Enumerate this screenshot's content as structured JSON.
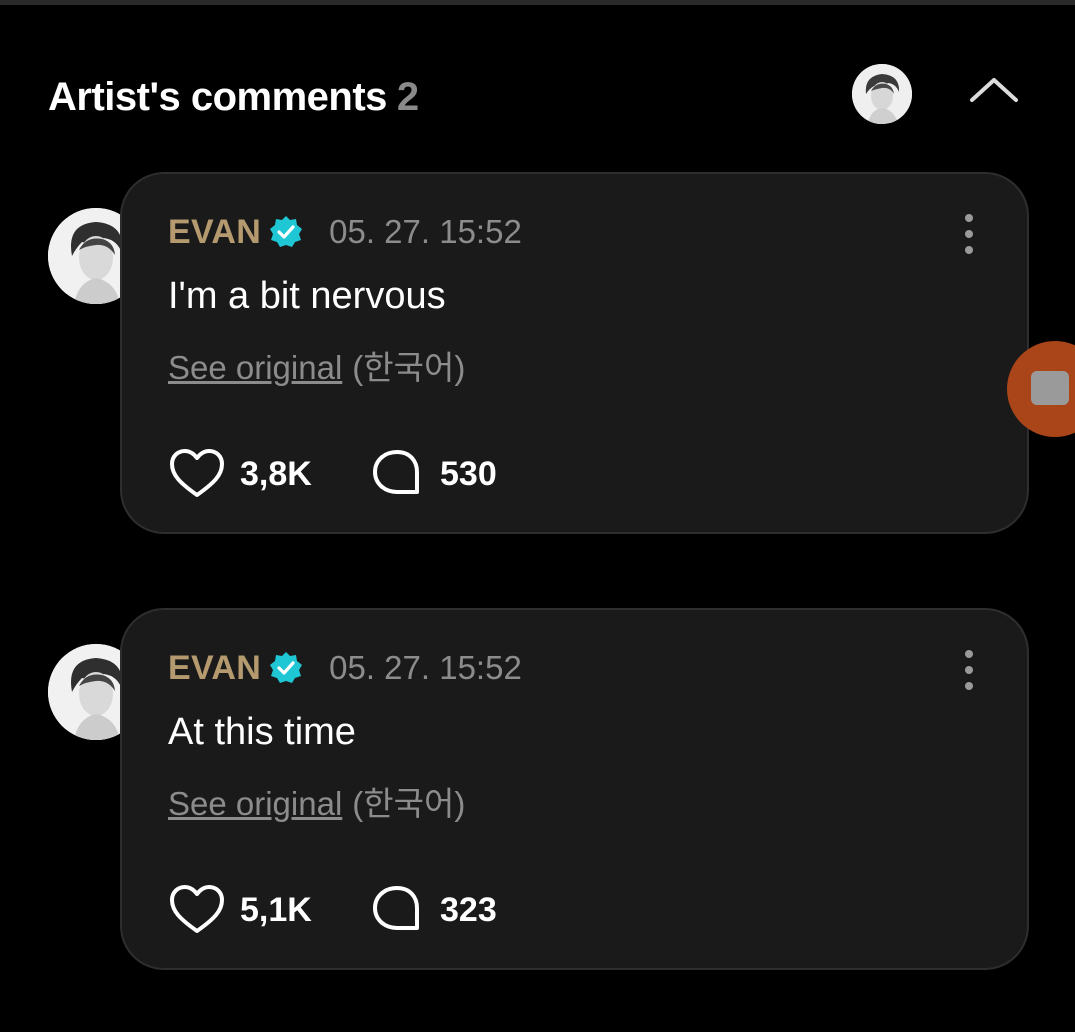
{
  "header": {
    "title": "Artist's comments",
    "count": "2",
    "avatar_icon": "artist-avatar",
    "collapse_icon": "chevron-up-icon"
  },
  "comments": [
    {
      "author": "EVAN",
      "verified_icon": "verified-badge-icon",
      "timestamp": "05. 27. 15:52",
      "text": "I'm a bit nervous",
      "see_original": "See original",
      "language": "(한국어)",
      "likes": "3,8K",
      "replies": "530"
    },
    {
      "author": "EVAN",
      "verified_icon": "verified-badge-icon",
      "timestamp": "05. 27. 15:52",
      "text": "At this time",
      "see_original": "See original",
      "language": "(한국어)",
      "likes": "5,1K",
      "replies": "323"
    }
  ],
  "colors": {
    "background": "#000000",
    "card": "#1a1a1a",
    "author": "#b49a6e",
    "verified": "#1fc7d4",
    "muted": "#8c8c8c",
    "floating_button": "#a94518"
  }
}
